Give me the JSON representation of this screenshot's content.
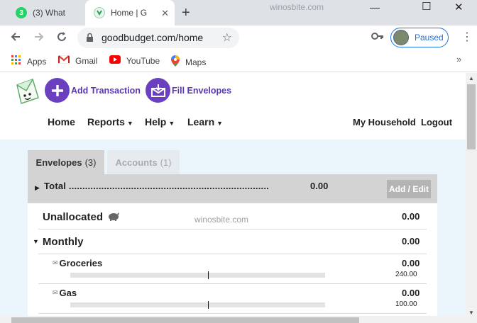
{
  "browser": {
    "tabs": [
      {
        "title": "(3) What",
        "favicon": "whatsapp-icon",
        "badge": "3",
        "color": "#25d366"
      },
      {
        "title": "Home | G",
        "favicon": "goodbudget-icon",
        "color": "#2e9e5b"
      }
    ],
    "watermark": "winosbite.com",
    "address": "goodbudget.com/home",
    "profile_label": "Paused",
    "bookmarks": [
      {
        "label": "Apps",
        "icon": "apps-grid-icon"
      },
      {
        "label": "Gmail",
        "icon": "gmail-icon"
      },
      {
        "label": "YouTube",
        "icon": "youtube-icon"
      },
      {
        "label": "Maps",
        "icon": "maps-pin-icon"
      }
    ]
  },
  "app": {
    "actions": {
      "add_transaction": "Add Transaction",
      "fill_envelopes": "Fill Envelopes"
    },
    "nav": {
      "home": "Home",
      "reports": "Reports",
      "help": "Help",
      "learn": "Learn",
      "household": "My Household",
      "logout": "Logout"
    },
    "tabs": {
      "envelopes": {
        "label": "Envelopes",
        "count": "(3)"
      },
      "accounts": {
        "label": "Accounts",
        "count": "(1)"
      }
    },
    "total": {
      "label": "Total ..........................................................................",
      "value": "0.00",
      "add_edit": "Add / Edit"
    },
    "unallocated": {
      "label": "Unallocated",
      "value": "0.00"
    },
    "monthly": {
      "label": "Monthly",
      "value": "0.00"
    },
    "envelopes": [
      {
        "name": "Groceries",
        "value": "0.00",
        "budget": "240.00",
        "progress": 0.54
      },
      {
        "name": "Gas",
        "value": "0.00",
        "budget": "100.00",
        "progress": 0.54
      }
    ],
    "watermark": "winosbite.com"
  },
  "colors": {
    "accent_purple": "#6a3fc0",
    "content_bg": "#eaf6fb",
    "chrome_blue": "#1a73e8"
  }
}
